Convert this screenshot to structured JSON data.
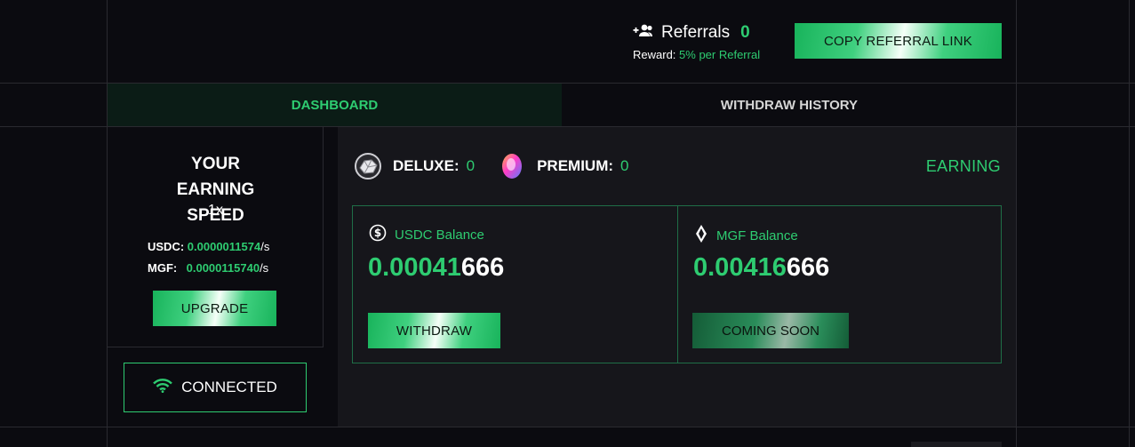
{
  "header": {
    "referrals_label": "Referrals",
    "referrals_count": "0",
    "reward_label": "Reward:",
    "reward_value": "5% per Referral",
    "copy_button": "COPY REFERRAL LINK"
  },
  "tabs": [
    {
      "label": "DASHBOARD",
      "active": true
    },
    {
      "label": "WITHDRAW HISTORY",
      "active": false
    }
  ],
  "speed": {
    "title": "YOUR EARNING SPEED",
    "multiplier": "1x",
    "usdc_label": "USDC:",
    "usdc_rate": "0.0000011574",
    "mgf_label": "MGF:",
    "mgf_rate": "0.0000115740",
    "unit": "/s",
    "upgrade_button": "UPGRADE"
  },
  "connection": {
    "status": "CONNECTED"
  },
  "tiers": {
    "deluxe_label": "DELUXE:",
    "deluxe_count": "0",
    "premium_label": "PREMIUM:",
    "premium_count": "0",
    "status": "EARNING"
  },
  "balances": {
    "usdc_label": "USDC Balance",
    "usdc_value_green": "0.00041",
    "usdc_value_white": "666",
    "withdraw_button": "WITHDRAW",
    "mgf_label": "MGF Balance",
    "mgf_value_green": "0.00416",
    "mgf_value_white": "666",
    "coming_soon_button": "COMING SOON"
  },
  "colors": {
    "accent": "#2ecc71",
    "background": "#0b0b10",
    "panel": "#16161b",
    "active_tab": "#0b1c16"
  }
}
